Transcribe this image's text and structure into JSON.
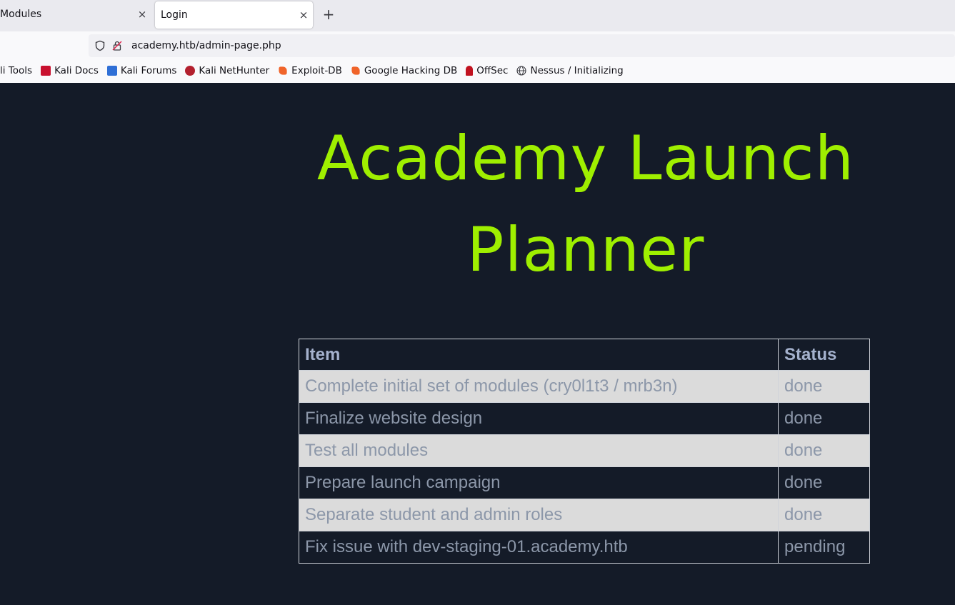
{
  "browser": {
    "tabs": [
      {
        "label": "Modules",
        "active": false
      },
      {
        "label": "Login",
        "active": true
      }
    ],
    "close_glyph": "×",
    "new_tab_glyph": "+",
    "url": "academy.htb/admin-page.php",
    "bookmarks": [
      {
        "label": "li Tools",
        "icon": "kali-tools-icon"
      },
      {
        "label": "Kali Docs",
        "icon": "kali-docs-icon"
      },
      {
        "label": "Kali Forums",
        "icon": "kali-forums-icon"
      },
      {
        "label": "Kali NetHunter",
        "icon": "kali-nethunter-icon"
      },
      {
        "label": "Exploit-DB",
        "icon": "exploit-db-icon"
      },
      {
        "label": "Google Hacking DB",
        "icon": "ghdb-icon"
      },
      {
        "label": "OffSec",
        "icon": "offsec-icon"
      },
      {
        "label": "Nessus / Initializing",
        "icon": "globe-icon"
      }
    ]
  },
  "page": {
    "title": "Academy Launch Planner",
    "title_color": "#9fef00",
    "background": "#141b28",
    "table": {
      "headers": [
        "Item",
        "Status"
      ],
      "rows": [
        {
          "item": "Complete initial set of modules (cry0l1t3 / mrb3n)",
          "status": "done"
        },
        {
          "item": "Finalize website design",
          "status": "done"
        },
        {
          "item": "Test all modules",
          "status": "done"
        },
        {
          "item": "Prepare launch campaign",
          "status": "done"
        },
        {
          "item": "Separate student and admin roles",
          "status": "done"
        },
        {
          "item": "Fix issue with dev-staging-01.academy.htb",
          "status": "pending"
        }
      ]
    }
  }
}
